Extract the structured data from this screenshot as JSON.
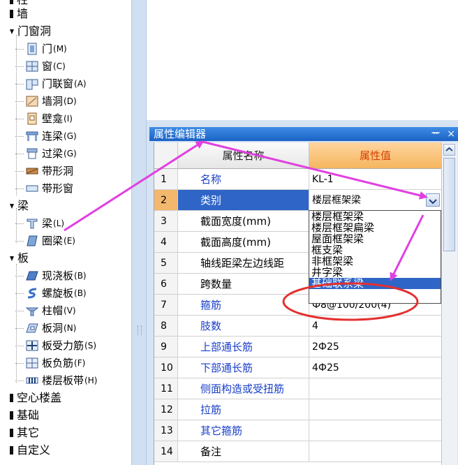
{
  "tree": {
    "categories": [
      {
        "label": "柱"
      },
      {
        "label": "墙"
      },
      {
        "label": "门窗洞"
      },
      {
        "label": "梁"
      },
      {
        "label": "板"
      },
      {
        "label": "空心楼盖"
      },
      {
        "label": "基础"
      },
      {
        "label": "其它"
      },
      {
        "label": "自定义"
      }
    ],
    "items": [
      {
        "label": "门",
        "key": "(M)",
        "icon": "door-icon"
      },
      {
        "label": "窗",
        "key": "(C)",
        "icon": "window-icon"
      },
      {
        "label": "门联窗",
        "key": "(A)",
        "icon": "door-window-icon"
      },
      {
        "label": "墙洞",
        "key": "(D)",
        "icon": "wall-hole-icon"
      },
      {
        "label": "壁龛",
        "key": "(I)",
        "icon": "niche-icon"
      },
      {
        "label": "连梁",
        "key": "(G)",
        "icon": "link-beam-icon"
      },
      {
        "label": "过梁",
        "key": "(G)",
        "icon": "lintel-icon"
      },
      {
        "label": "带形洞",
        "key": "",
        "icon": "strip-hole-icon"
      },
      {
        "label": "带形窗",
        "key": "",
        "icon": "strip-window-icon"
      },
      {
        "label": "梁",
        "key": "(L)",
        "icon": "beam-icon"
      },
      {
        "label": "圈梁",
        "key": "(E)",
        "icon": "ring-beam-icon"
      },
      {
        "label": "现浇板",
        "key": "(B)",
        "icon": "cast-slab-icon"
      },
      {
        "label": "螺旋板",
        "key": "(B)",
        "icon": "spiral-slab-icon"
      },
      {
        "label": "柱帽",
        "key": "(V)",
        "icon": "column-cap-icon"
      },
      {
        "label": "板洞",
        "key": "(N)",
        "icon": "slab-hole-icon"
      },
      {
        "label": "板受力筋",
        "key": "(S)",
        "icon": "slab-rebar-icon"
      },
      {
        "label": "板负筋",
        "key": "(F)",
        "icon": "negative-rebar-icon"
      },
      {
        "label": "楼层板带",
        "key": "(H)",
        "icon": "floor-strip-icon"
      }
    ]
  },
  "panel": {
    "title": "属性编辑器",
    "pin": "ᅲ",
    "close": "×",
    "header_name": "属性名称",
    "header_value": "属性值"
  },
  "rows": [
    {
      "idx": "1",
      "name": "名称",
      "value": "KL-1"
    },
    {
      "idx": "2",
      "name": "类别",
      "value": "楼层框架梁"
    },
    {
      "idx": "3",
      "name": "截面宽度(mm)",
      "value": ""
    },
    {
      "idx": "4",
      "name": "截面高度(mm)",
      "value": ""
    },
    {
      "idx": "5",
      "name": "轴线距梁左边线距",
      "value": ""
    },
    {
      "idx": "6",
      "name": "跨数量",
      "value": ""
    },
    {
      "idx": "7",
      "name": "箍筋",
      "value": "Ф8@100/200(4)"
    },
    {
      "idx": "8",
      "name": "肢数",
      "value": "4"
    },
    {
      "idx": "9",
      "name": "上部通长筋",
      "value": "2Ф25"
    },
    {
      "idx": "10",
      "name": "下部通长筋",
      "value": "4Ф25"
    },
    {
      "idx": "11",
      "name": "侧面构造或受扭筋",
      "value": ""
    },
    {
      "idx": "12",
      "name": "拉筋",
      "value": ""
    },
    {
      "idx": "13",
      "name": "其它箍筋",
      "value": ""
    },
    {
      "idx": "14",
      "name": "备注",
      "value": ""
    }
  ],
  "dropdown": {
    "options": [
      "楼层框架梁",
      "楼层框架扁梁",
      "屋面框架梁",
      "框支梁",
      "非框架梁",
      "井字梁",
      "基础联系梁"
    ],
    "highlighted": "基础联系梁"
  },
  "colors": {
    "annotation_arrow": "#e040e0",
    "annotation_ellipse": "#e53030",
    "selection": "#2f65c6",
    "header_value": "#d43e00",
    "property_name_blue": "#1a3fc8"
  }
}
